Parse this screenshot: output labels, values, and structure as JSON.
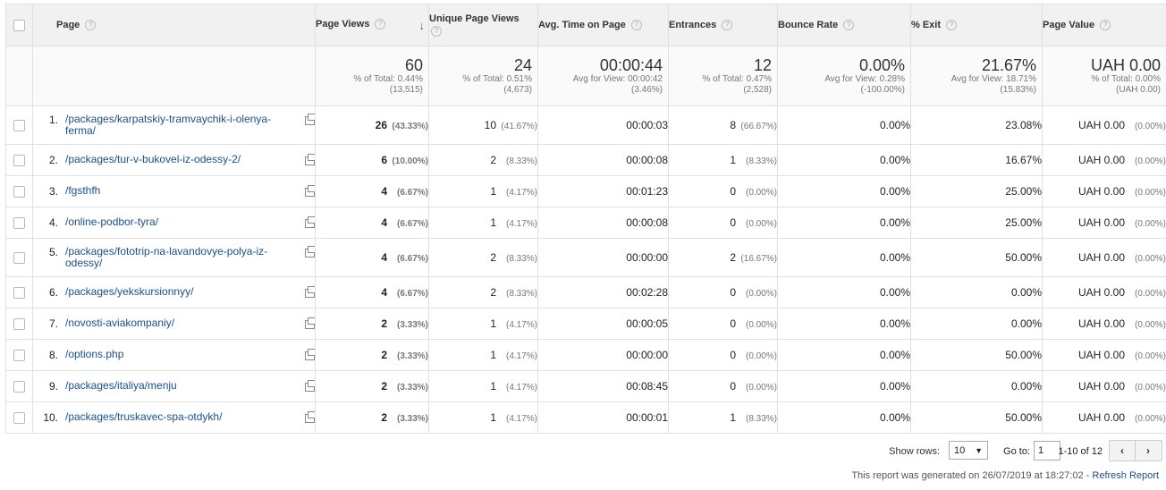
{
  "headers": {
    "page": "Page",
    "page_views": "Page Views",
    "unique_page_views": "Unique Page Views",
    "avg_time": "Avg. Time on Page",
    "entrances": "Entrances",
    "bounce_rate": "Bounce Rate",
    "exit": "% Exit",
    "page_value": "Page Value"
  },
  "totals": {
    "page_views": {
      "value": "60",
      "sub1": "% of Total: 0.44%",
      "sub2": "(13,515)"
    },
    "unique_page_views": {
      "value": "24",
      "sub1": "% of Total: 0.51%",
      "sub2": "(4,673)"
    },
    "avg_time": {
      "value": "00:00:44",
      "sub1": "Avg for View: 00:00:42",
      "sub2": "(3.46%)"
    },
    "entrances": {
      "value": "12",
      "sub1": "% of Total: 0.47%",
      "sub2": "(2,528)"
    },
    "bounce_rate": {
      "value": "0.00%",
      "sub1": "Avg for View: 0.28%",
      "sub2": "(-100.00%)"
    },
    "exit": {
      "value": "21.67%",
      "sub1": "Avg for View: 18.71%",
      "sub2": "(15.83%)"
    },
    "page_value": {
      "value": "UAH 0.00",
      "sub1": "% of Total: 0.00%",
      "sub2": "(UAH 0.00)"
    }
  },
  "rows": [
    {
      "num": "1.",
      "page": "/packages/karpatskiy-tramvaychik-i-olenya-ferma/",
      "pv": "26",
      "pv_pct": "(43.33%)",
      "upv": "10",
      "upv_pct": "(41.67%)",
      "time": "00:00:03",
      "ent": "8",
      "ent_pct": "(66.67%)",
      "bounce": "0.00%",
      "exit": "23.08%",
      "value": "UAH 0.00",
      "value_pct": "(0.00%)"
    },
    {
      "num": "2.",
      "page": "/packages/tur-v-bukovel-iz-odessy-2/",
      "pv": "6",
      "pv_pct": "(10.00%)",
      "upv": "2",
      "upv_pct": "(8.33%)",
      "time": "00:00:08",
      "ent": "1",
      "ent_pct": "(8.33%)",
      "bounce": "0.00%",
      "exit": "16.67%",
      "value": "UAH 0.00",
      "value_pct": "(0.00%)"
    },
    {
      "num": "3.",
      "page": "/fgsthfh",
      "pv": "4",
      "pv_pct": "(6.67%)",
      "upv": "1",
      "upv_pct": "(4.17%)",
      "time": "00:01:23",
      "ent": "0",
      "ent_pct": "(0.00%)",
      "bounce": "0.00%",
      "exit": "25.00%",
      "value": "UAH 0.00",
      "value_pct": "(0.00%)"
    },
    {
      "num": "4.",
      "page": "/online-podbor-tyra/",
      "pv": "4",
      "pv_pct": "(6.67%)",
      "upv": "1",
      "upv_pct": "(4.17%)",
      "time": "00:00:08",
      "ent": "0",
      "ent_pct": "(0.00%)",
      "bounce": "0.00%",
      "exit": "25.00%",
      "value": "UAH 0.00",
      "value_pct": "(0.00%)"
    },
    {
      "num": "5.",
      "page": "/packages/fototrip-na-lavandovye-polya-iz-odessy/",
      "pv": "4",
      "pv_pct": "(6.67%)",
      "upv": "2",
      "upv_pct": "(8.33%)",
      "time": "00:00:00",
      "ent": "2",
      "ent_pct": "(16.67%)",
      "bounce": "0.00%",
      "exit": "50.00%",
      "value": "UAH 0.00",
      "value_pct": "(0.00%)"
    },
    {
      "num": "6.",
      "page": "/packages/yekskursionnyy/",
      "pv": "4",
      "pv_pct": "(6.67%)",
      "upv": "2",
      "upv_pct": "(8.33%)",
      "time": "00:02:28",
      "ent": "0",
      "ent_pct": "(0.00%)",
      "bounce": "0.00%",
      "exit": "0.00%",
      "value": "UAH 0.00",
      "value_pct": "(0.00%)"
    },
    {
      "num": "7.",
      "page": "/novosti-aviakompaniy/",
      "pv": "2",
      "pv_pct": "(3.33%)",
      "upv": "1",
      "upv_pct": "(4.17%)",
      "time": "00:00:05",
      "ent": "0",
      "ent_pct": "(0.00%)",
      "bounce": "0.00%",
      "exit": "0.00%",
      "value": "UAH 0.00",
      "value_pct": "(0.00%)"
    },
    {
      "num": "8.",
      "page": "/options.php",
      "pv": "2",
      "pv_pct": "(3.33%)",
      "upv": "1",
      "upv_pct": "(4.17%)",
      "time": "00:00:00",
      "ent": "0",
      "ent_pct": "(0.00%)",
      "bounce": "0.00%",
      "exit": "50.00%",
      "value": "UAH 0.00",
      "value_pct": "(0.00%)"
    },
    {
      "num": "9.",
      "page": "/packages/italiya/menju",
      "pv": "2",
      "pv_pct": "(3.33%)",
      "upv": "1",
      "upv_pct": "(4.17%)",
      "time": "00:08:45",
      "ent": "0",
      "ent_pct": "(0.00%)",
      "bounce": "0.00%",
      "exit": "0.00%",
      "value": "UAH 0.00",
      "value_pct": "(0.00%)"
    },
    {
      "num": "10.",
      "page": "/packages/truskavec-spa-otdykh/",
      "pv": "2",
      "pv_pct": "(3.33%)",
      "upv": "1",
      "upv_pct": "(4.17%)",
      "time": "00:00:01",
      "ent": "1",
      "ent_pct": "(8.33%)",
      "bounce": "0.00%",
      "exit": "50.00%",
      "value": "UAH 0.00",
      "value_pct": "(0.00%)"
    }
  ],
  "footer": {
    "show_rows_label": "Show rows:",
    "rows_value": "10",
    "goto_label": "Go to:",
    "goto_value": "1",
    "range": "1-10 of 12",
    "prev": "‹",
    "next": "›",
    "generated": "This report was generated on 26/07/2019 at 18:27:02 - ",
    "refresh": "Refresh Report"
  }
}
